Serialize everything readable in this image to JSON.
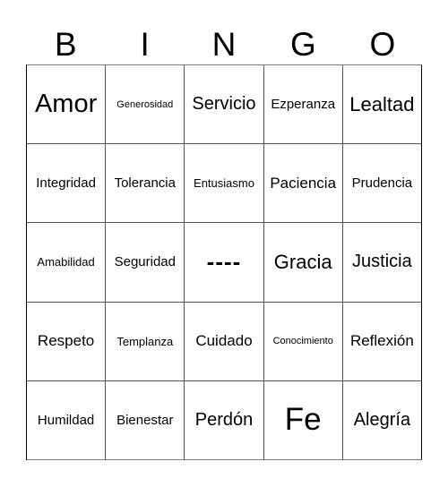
{
  "header": {
    "letters": [
      "B",
      "I",
      "N",
      "G",
      "O"
    ]
  },
  "board": {
    "rows": [
      [
        {
          "text": "Amor",
          "size": "huge"
        },
        {
          "text": "Generosidad",
          "size": "xs"
        },
        {
          "text": "Servicio",
          "size": "xl"
        },
        {
          "text": "Ezperanza",
          "size": "md"
        },
        {
          "text": "Lealtad",
          "size": "xxl"
        }
      ],
      [
        {
          "text": "Integridad",
          "size": "md"
        },
        {
          "text": "Tolerancia",
          "size": "md"
        },
        {
          "text": "Entusiasmo",
          "size": "sm"
        },
        {
          "text": "Paciencia",
          "size": "lg"
        },
        {
          "text": "Prudencia",
          "size": "md"
        }
      ],
      [
        {
          "text": "Amabilidad",
          "size": "sm"
        },
        {
          "text": "Seguridad",
          "size": "md"
        },
        {
          "text": "----",
          "size": "free"
        },
        {
          "text": "Gracia",
          "size": "xxl"
        },
        {
          "text": "Justicia",
          "size": "xl"
        }
      ],
      [
        {
          "text": "Respeto",
          "size": "lg"
        },
        {
          "text": "Templanza",
          "size": "sm"
        },
        {
          "text": "Cuidado",
          "size": "lg"
        },
        {
          "text": "Conocimiento",
          "size": "xs"
        },
        {
          "text": "Reflexión",
          "size": "lg"
        }
      ],
      [
        {
          "text": "Humildad",
          "size": "md"
        },
        {
          "text": "Bienestar",
          "size": "md"
        },
        {
          "text": "Perdón",
          "size": "xl"
        },
        {
          "text": "Fe",
          "size": "giant"
        },
        {
          "text": "Alegría",
          "size": "xl"
        }
      ]
    ]
  }
}
